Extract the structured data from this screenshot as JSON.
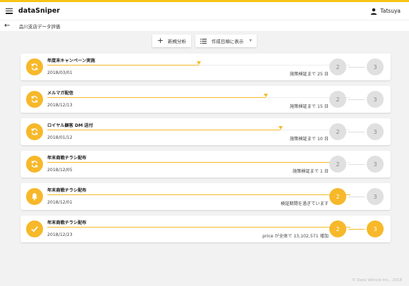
{
  "header": {
    "app_title": "dataSniper",
    "user_name": "Tatsuya"
  },
  "breadcrumb": {
    "label": "品川支店データ評価"
  },
  "toolbar": {
    "new_analysis": "新規分析",
    "sort_select": "作成日順に表示"
  },
  "cards": [
    {
      "title": "年度末キャンペーン実施",
      "date": "2018/03/01",
      "status": "施策検証まで 25 日",
      "icon": "refresh-icon",
      "progress": 0.5,
      "step2": "2",
      "step3": "3",
      "active_steps": 0
    },
    {
      "title": "メルマガ配信",
      "date": "2018/12/13",
      "status": "施策検証まで 15 日",
      "icon": "refresh-icon",
      "progress": 0.72,
      "step2": "2",
      "step3": "3",
      "active_steps": 0
    },
    {
      "title": "ロイヤル顧客 DM 送付",
      "date": "2018/01/12",
      "status": "施策検証まで 10 日",
      "icon": "refresh-icon",
      "progress": 0.77,
      "step2": "2",
      "step3": "3",
      "active_steps": 0
    },
    {
      "title": "年末商戦チラシ配布",
      "date": "2018/12/05",
      "status": "施策検証まで 1 日",
      "icon": "refresh-icon",
      "progress": 0.95,
      "step2": "2",
      "step3": "3",
      "active_steps": 0
    },
    {
      "title": "年末商戦チラシ配布",
      "date": "2018/12/01",
      "status": "検証期間を過ぎています",
      "icon": "bell-icon",
      "progress": 1.0,
      "step2": "2",
      "step3": "3",
      "active_steps": 1
    },
    {
      "title": "年末商戦チラシ配布",
      "date": "2018/12/23",
      "status": "price が全体で 13,102,571 増加",
      "icon": "check-icon",
      "progress": 1.0,
      "step2": "2",
      "step3": "3",
      "active_steps": 2
    }
  ],
  "footer": {
    "copyright": "© Data Vehicle Inc., 2018"
  },
  "colors": {
    "accent": "#f7b829",
    "inactive": "#e0e0e0"
  }
}
